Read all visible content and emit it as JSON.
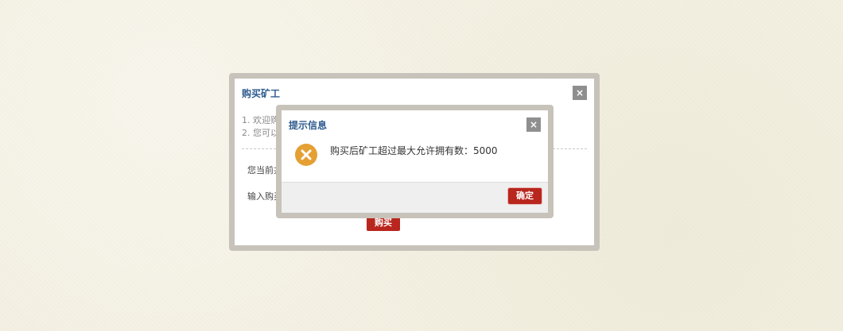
{
  "outer_dialog": {
    "title": "购买矿工",
    "close_label": "×",
    "notes": [
      "1. 欢迎购买",
      "2. 您可以2"
    ],
    "current_label": "您当前共",
    "input_label": "输入购买",
    "buy_label": "购买"
  },
  "alert_dialog": {
    "title": "提示信息",
    "close_label": "×",
    "icon": "error-x-icon",
    "message": "购买后矿工超过最大允许拥有数：5000",
    "confirm_label": "确定"
  },
  "colors": {
    "title_blue": "#2f5c8f",
    "button_red": "#b8261d",
    "icon_orange": "#e5a033",
    "frame_gray": "#c7c3ba"
  }
}
